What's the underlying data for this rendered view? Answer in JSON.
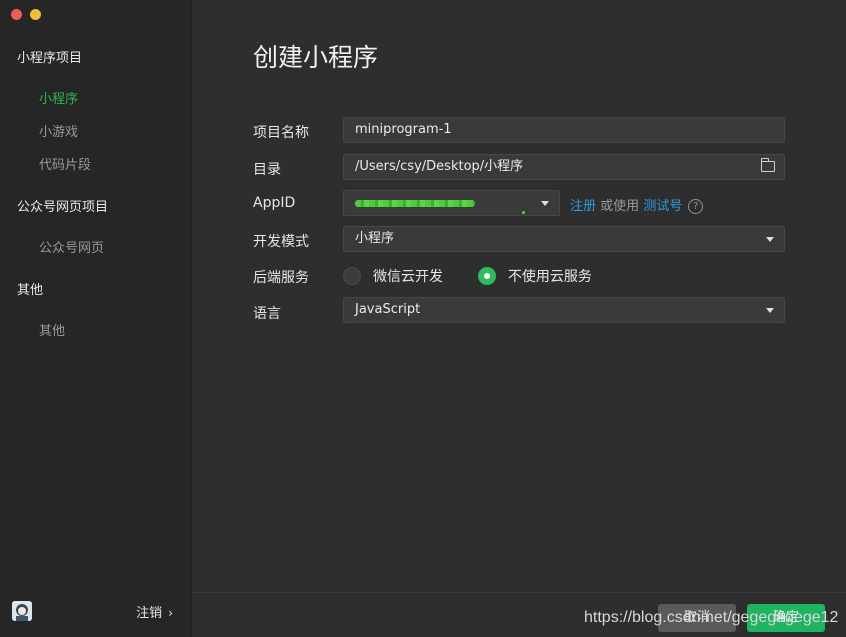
{
  "window": {
    "traffic_lights": [
      "close",
      "minimize"
    ]
  },
  "sidebar": {
    "sections": [
      {
        "title": "小程序项目",
        "items": [
          "小程序",
          "小游戏",
          "代码片段"
        ]
      },
      {
        "title": "公众号网页项目",
        "items": [
          "公众号网页"
        ]
      },
      {
        "title": "其他",
        "items": [
          "其他"
        ]
      }
    ],
    "active_item": "小程序",
    "logout_label": "注销",
    "logout_chevron": "›"
  },
  "main": {
    "title": "创建小程序",
    "fields": {
      "project_name": {
        "label": "项目名称",
        "value": "miniprogram-1"
      },
      "directory": {
        "label": "目录",
        "value": "/Users/csy/Desktop/小程序"
      },
      "appid": {
        "label": "AppID",
        "register_link": "注册",
        "or_use": "或使用",
        "test_link": "测试号",
        "help": "?"
      },
      "dev_mode": {
        "label": "开发模式",
        "value": "小程序"
      },
      "backend": {
        "label": "后端服务",
        "options": [
          "微信云开发",
          "不使用云服务"
        ],
        "selected": "不使用云服务"
      },
      "language": {
        "label": "语言",
        "value": "JavaScript"
      }
    }
  },
  "footer": {
    "cancel_label": "取消",
    "ok_label": "确定",
    "watermark": "https://blog.csdn.net/gegegegege12"
  },
  "colors": {
    "accent_green": "#2bb94f",
    "link_blue": "#2f9bdf",
    "ok_button": "#1fb461"
  }
}
